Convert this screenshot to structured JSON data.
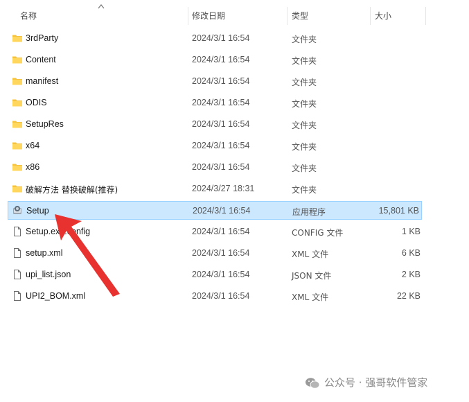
{
  "header": {
    "name_label": "名称",
    "date_label": "修改日期",
    "type_label": "类型",
    "size_label": "大小"
  },
  "rows": [
    {
      "name": "3rdParty",
      "date": "2024/3/1 16:54",
      "type": "文件夹",
      "size": "",
      "icon": "folder-icon"
    },
    {
      "name": "Content",
      "date": "2024/3/1 16:54",
      "type": "文件夹",
      "size": "",
      "icon": "folder-icon"
    },
    {
      "name": "manifest",
      "date": "2024/3/1 16:54",
      "type": "文件夹",
      "size": "",
      "icon": "folder-icon"
    },
    {
      "name": "ODIS",
      "date": "2024/3/1 16:54",
      "type": "文件夹",
      "size": "",
      "icon": "folder-icon"
    },
    {
      "name": "SetupRes",
      "date": "2024/3/1 16:54",
      "type": "文件夹",
      "size": "",
      "icon": "folder-icon"
    },
    {
      "name": "x64",
      "date": "2024/3/1 16:54",
      "type": "文件夹",
      "size": "",
      "icon": "folder-icon"
    },
    {
      "name": "x86",
      "date": "2024/3/1 16:54",
      "type": "文件夹",
      "size": "",
      "icon": "folder-icon"
    },
    {
      "name": "破解方法 替换破解(推荐)",
      "date": "2024/3/27 18:31",
      "type": "文件夹",
      "size": "",
      "icon": "folder-icon"
    },
    {
      "name": "Setup",
      "date": "2024/3/1 16:54",
      "type": "应用程序",
      "size": "15,801 KB",
      "icon": "setup-app-icon"
    },
    {
      "name": "Setup.exe.config",
      "date": "2024/3/1 16:54",
      "type": "CONFIG 文件",
      "size": "1 KB",
      "icon": "file-icon"
    },
    {
      "name": "setup.xml",
      "date": "2024/3/1 16:54",
      "type": "XML 文件",
      "size": "6 KB",
      "icon": "file-icon"
    },
    {
      "name": "upi_list.json",
      "date": "2024/3/1 16:54",
      "type": "JSON 文件",
      "size": "2 KB",
      "icon": "file-icon"
    },
    {
      "name": "UPI2_BOM.xml",
      "date": "2024/3/1 16:54",
      "type": "XML 文件",
      "size": "22 KB",
      "icon": "file-icon"
    }
  ],
  "watermark": {
    "text": "公众号 · 强哥软件管家",
    "icon": "wechat-logo-icon"
  },
  "colors": {
    "folder": "#f5c342",
    "selection_bg": "#cce8ff",
    "selection_border": "#99d1ff",
    "arrow": "#e8322f"
  }
}
